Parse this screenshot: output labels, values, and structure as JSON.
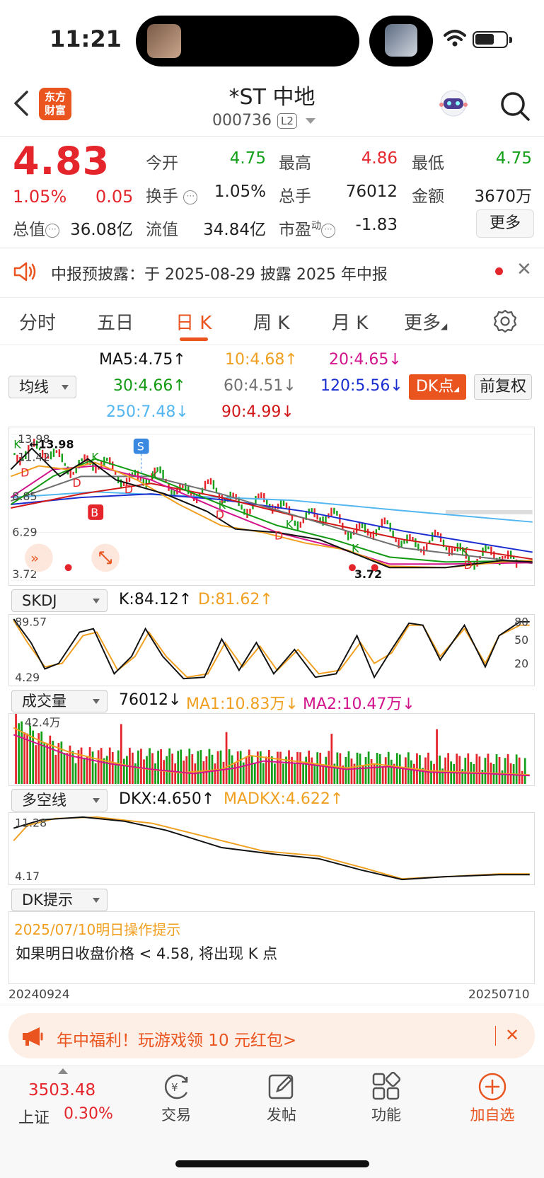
{
  "status_bar": {
    "time": "11:21"
  },
  "header": {
    "logo_line1": "东方",
    "logo_line2": "财富",
    "stock_name": "*ST 中地",
    "stock_code": "000736",
    "level_badge": "L2"
  },
  "quote": {
    "price": "4.83",
    "change_pct": "1.05%",
    "change_abs": "0.05",
    "open_label": "今开",
    "open": "4.75",
    "high_label": "最高",
    "high": "4.86",
    "low_label": "最低",
    "low": "4.75",
    "turnover_label": "换手",
    "turnover": "1.05%",
    "volume_label": "总手",
    "volume": "76012",
    "amount_label": "金额",
    "amount": "3670万",
    "mktcap_label": "总值",
    "mktcap": "36.08亿",
    "float_label": "流值",
    "float_cap": "34.84亿",
    "pe_label": "市盈",
    "pe_sup": "动",
    "pe": "-1.83",
    "more_label": "更多"
  },
  "notice": {
    "text": "中报预披露：于 2025-08-29 披露 2025 年中报"
  },
  "tabs": [
    "分时",
    "五日",
    "日 K",
    "周 K",
    "月 K",
    "更多"
  ],
  "ma": {
    "selector": "均线",
    "ma5": "MA5:4.75↑",
    "ma10": "10:4.68↑",
    "ma20": "20:4.65↓",
    "ma30": "30:4.66↑",
    "ma60": "60:4.51↓",
    "ma120": "120:5.56↓",
    "ma250": "250:7.48↓",
    "ma90": "90:4.99↓",
    "dk_button": "DK点",
    "adjust_button": "前复权",
    "colors": {
      "ma5": "#111111",
      "ma10": "#f0a020",
      "ma20": "#d2148c",
      "ma30": "#139a13",
      "ma60": "#707070",
      "ma120": "#1a2ed0",
      "ma250": "#52b6f0",
      "ma90": "#d01818"
    }
  },
  "kline_axis": {
    "top": "13.98",
    "label2": "11.42",
    "mid": "8.85",
    "low": "6.29",
    "bottom": "3.72",
    "max_mark": "←13.98",
    "min_mark": "3.72"
  },
  "kline_markers": {
    "s": "S",
    "b": "B",
    "k": "K",
    "d": "D"
  },
  "skdj": {
    "selector": "SKDJ",
    "k": "K:84.12↑",
    "d": "D:81.62↑",
    "top": "89.57",
    "bottom": "4.29",
    "r80": "80",
    "r50": "50",
    "r20": "20"
  },
  "volume": {
    "selector": "成交量",
    "value": "76012↓",
    "ma1": "MA1:10.83万↓",
    "ma2": "MA2:10.47万↓",
    "top": "42.4万"
  },
  "dkx": {
    "selector": "多空线",
    "dkx": "DKX:4.650↑",
    "madkx": "MADKX:4.622↑",
    "top": "11.28",
    "bottom": "4.17"
  },
  "dk_hint": {
    "selector": "DK提示",
    "date_line": "2025/07/10明日操作提示",
    "message": "如果明日收盘价格 < 4.58, 将出现 K 点"
  },
  "date_range": {
    "start": "20240924",
    "end": "20250710"
  },
  "promo": {
    "text": "年中福利！玩游戏领 10 元红包>"
  },
  "bottom_nav": {
    "index_value": "3503.48",
    "index_name": "上证",
    "index_change": "0.30%",
    "trade": "交易",
    "post": "发帖",
    "function": "功能",
    "add_watch": "加自选"
  }
}
